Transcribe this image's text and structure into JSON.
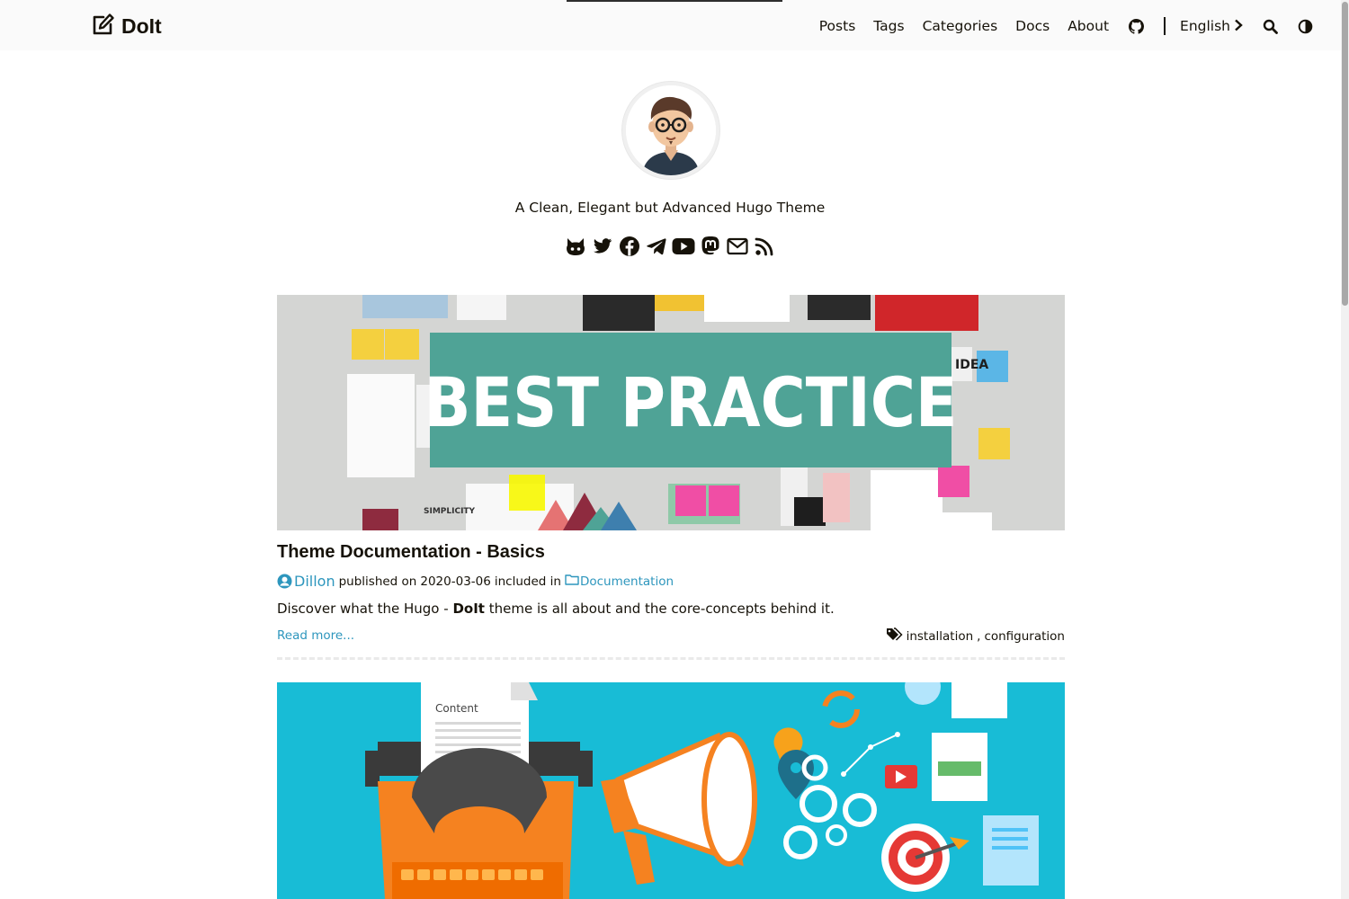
{
  "header": {
    "logo_text": "DoIt",
    "nav": [
      "Posts",
      "Tags",
      "Categories",
      "Docs",
      "About"
    ],
    "language": "English"
  },
  "profile": {
    "subtitle": "A Clean, Elegant but Advanced Hugo Theme",
    "social_icons": [
      "github-icon",
      "twitter-icon",
      "facebook-icon",
      "telegram-icon",
      "youtube-icon",
      "mastodon-icon",
      "email-icon",
      "rss-icon"
    ]
  },
  "posts": [
    {
      "image_text": "BEST PRACTICE",
      "image_labels": [
        "IDEA",
        "SIMPLICITY"
      ],
      "title": "Theme Documentation - Basics",
      "author": "Dillon",
      "published_label": "published on",
      "date": "2020-03-06",
      "included_label": "included in",
      "category": "Documentation",
      "summary_before": "Discover what the Hugo - ",
      "summary_bold": "DoIt",
      "summary_after": " theme is all about and the core-concepts behind it.",
      "read_more": "Read more...",
      "tags": [
        "installation",
        "configuration"
      ]
    },
    {
      "image_text": "Content"
    }
  ],
  "colors": {
    "accent": "#2d96bd",
    "text": "#161209",
    "header_bg": "#fafafa",
    "banner_teal": "#4fa396",
    "post2_bg": "#18bcd6"
  }
}
